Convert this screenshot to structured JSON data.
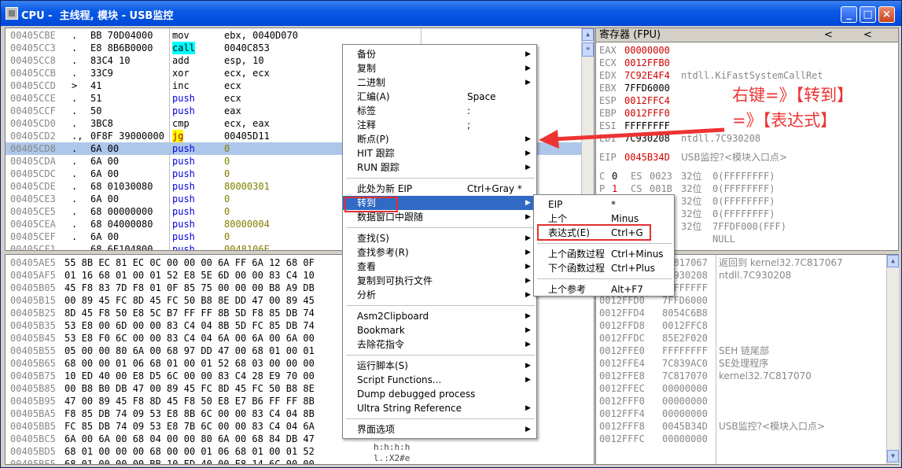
{
  "window": {
    "title": "CPU -  主线程, 模块 - USB监控",
    "min": "_",
    "max": "□",
    "close": "×"
  },
  "disasm": [
    {
      "addr": "00405CBE",
      "mark": ".",
      "hex": "BB 70D04000",
      "mn": "mov",
      "op": "ebx, 0040D070"
    },
    {
      "addr": "00405CC3",
      "mark": ".",
      "hex": "E8 8B6B0000",
      "mn": "call",
      "op": "0040C853"
    },
    {
      "addr": "00405CC8",
      "mark": ".",
      "hex": "83C4 10",
      "mn": "add",
      "op": "esp, 10"
    },
    {
      "addr": "00405CCB",
      "mark": ".",
      "hex": "33C9",
      "mn": "xor",
      "op": "ecx, ecx"
    },
    {
      "addr": "00405CCD",
      "mark": ">",
      "hex": "41",
      "mn": "inc",
      "op": "ecx"
    },
    {
      "addr": "00405CCE",
      "mark": ".",
      "hex": "51",
      "mn": "push",
      "op": "ecx"
    },
    {
      "addr": "00405CCF",
      "mark": ".",
      "hex": "50",
      "mn": "push",
      "op": "eax"
    },
    {
      "addr": "00405CD0",
      "mark": ".",
      "hex": "3BC8",
      "mn": "cmp",
      "op": "ecx, eax"
    },
    {
      "addr": "00405CD2",
      "mark": ".,",
      "hex": "0F8F 39000000",
      "mn": "jg",
      "op": "00405D11"
    },
    {
      "addr": "00405CD8",
      "mark": ".",
      "hex": "6A 00",
      "mn": "push",
      "op": "0"
    },
    {
      "addr": "00405CDA",
      "mark": ".",
      "hex": "6A 00",
      "mn": "push",
      "op": "0"
    },
    {
      "addr": "00405CDC",
      "mark": ".",
      "hex": "6A 00",
      "mn": "push",
      "op": "0"
    },
    {
      "addr": "00405CDE",
      "mark": ".",
      "hex": "68 01030080",
      "mn": "push",
      "op": "80000301"
    },
    {
      "addr": "00405CE3",
      "mark": ".",
      "hex": "6A 00",
      "mn": "push",
      "op": "0"
    },
    {
      "addr": "00405CE5",
      "mark": ".",
      "hex": "68 00000000",
      "mn": "push",
      "op": "0"
    },
    {
      "addr": "00405CEA",
      "mark": ".",
      "hex": "68 04000080",
      "mn": "push",
      "op": "80000004"
    },
    {
      "addr": "00405CEF",
      "mark": ".",
      "hex": "6A 00",
      "mn": "push",
      "op": "0"
    },
    {
      "addr": "00405CF1",
      "mark": ".",
      "hex": "68 6E104800",
      "mn": "push",
      "op": "0048106E"
    }
  ],
  "dump": [
    {
      "addr": "00405AE5",
      "hex": "55 8B EC 81 EC 0C 00 00 00 6A FF 6A 12 68 0F"
    },
    {
      "addr": "00405AF5",
      "hex": "01 16 68 01 00 01 52 E8 5E 6D 00 00 83 C4 10"
    },
    {
      "addr": "00405B05",
      "hex": "45 F8 83 7D F8 01 0F 85 75 00 00 00 B8 A9 DB"
    },
    {
      "addr": "00405B15",
      "hex": "00 89 45 FC 8D 45 FC 50 B8 8E DD 47 00 89 45"
    },
    {
      "addr": "00405B25",
      "hex": "8D 45 F8 50 E8 5C B7 FF FF 8B 5D F8 85 DB 74"
    },
    {
      "addr": "00405B35",
      "hex": "53 E8 00 6D 00 00 83 C4 04 8B 5D FC 85 DB 74"
    },
    {
      "addr": "00405B45",
      "hex": "53 E8 F0 6C 00 00 83 C4 04 6A 00 6A 00 6A 00"
    },
    {
      "addr": "00405B55",
      "hex": "05 00 00 80 6A 00 68 97 DD 47 00 68 01 00 01"
    },
    {
      "addr": "00405B65",
      "hex": "68 00 00 01 06 68 01 00 01 52 68 03 00 00 00"
    },
    {
      "addr": "00405B75",
      "hex": "10 ED 40 00 E8 D5 6C 00 00 83 C4 28 E9 70 00"
    },
    {
      "addr": "00405B85",
      "hex": "00 B8 B0 DB 47 00 89 45 FC 8D 45 FC 50 B8 8E"
    },
    {
      "addr": "00405B95",
      "hex": "47 00 89 45 F8 8D 45 F8 50 E8 E7 B6 FF FF 8B"
    },
    {
      "addr": "00405BA5",
      "hex": "F8 85 DB 74 09 53 E8 8B 6C 00 00 83 C4 04 8B"
    },
    {
      "addr": "00405BB5",
      "hex": "FC 85 DB 74 09 53 E8 7B 6C 00 00 83 C4 04 6A"
    },
    {
      "addr": "00405BC5",
      "hex": "6A 00 6A 00 68 04 00 00 80 6A 00 68 84 DB 47"
    },
    {
      "addr": "00405BD5",
      "hex": "68 01 00 00 00 68 00 00 01 06 68 01 00 01 52"
    },
    {
      "addr": "00405BE5",
      "hex": "68 01 00 00 00 BB 10 ED 40 00 E8 14 6C 00 00"
    }
  ],
  "dump_ascii": [
    "h:h:h:h",
    "l.:X2#e  "
  ],
  "registers": {
    "header": "寄存器 (FPU)",
    "nav": [
      "<",
      "<"
    ],
    "gp": [
      {
        "n": "EAX",
        "v": "00000000",
        "c": ""
      },
      {
        "n": "ECX",
        "v": "0012FFB0",
        "c": ""
      },
      {
        "n": "EDX",
        "v": "7C92E4F4",
        "c": "ntdll.KiFastSystemCallRet"
      },
      {
        "n": "EBX",
        "v": "7FFD6000",
        "c": ""
      },
      {
        "n": "ESP",
        "v": "0012FFC4",
        "c": ""
      },
      {
        "n": "EBP",
        "v": "0012FFF0",
        "c": ""
      },
      {
        "n": "ESI",
        "v": "FFFFFFFF",
        "c": ""
      },
      {
        "n": "EDI",
        "v": "7C930208",
        "c": "ntdll.7C930208"
      }
    ],
    "eip": {
      "n": "EIP",
      "v": "0045B34D",
      "c": "USB监控?<模块入口点>"
    },
    "seg": [
      {
        "f": "C",
        "b": "0",
        "s": "ES",
        "v": "0023",
        "w": "32位",
        "r": "0(FFFFFFFF)"
      },
      {
        "f": "P",
        "b": "1",
        "s": "CS",
        "v": "001B",
        "w": "32位",
        "r": "0(FFFFFFFF)"
      },
      {
        "f": "",
        "b": "",
        "s": "",
        "v": "",
        "w": "32位",
        "r": "0(FFFFFFFF)"
      },
      {
        "f": "",
        "b": "",
        "s": "",
        "v": "",
        "w": "32位",
        "r": "0(FFFFFFFF)"
      },
      {
        "f": "",
        "b": "",
        "s": "",
        "v": "",
        "w": "32位",
        "r": "7FFDF000(FFF)"
      },
      {
        "f": "",
        "b": "",
        "s": "",
        "v": "",
        "w": "",
        "r": "NULL"
      }
    ]
  },
  "stack": [
    {
      "a": "",
      "v": "7C817067",
      "c": "返回到 kernel32.7C817067"
    },
    {
      "a": "",
      "v": "7C930208",
      "c": "ntdll.7C930208"
    },
    {
      "a": "",
      "v": "FFFFFFFF",
      "c": ""
    },
    {
      "a": "0012FFD0",
      "v": "7FFD6000",
      "c": ""
    },
    {
      "a": "0012FFD4",
      "v": "8054C6B8",
      "c": ""
    },
    {
      "a": "0012FFD8",
      "v": "0012FFC8",
      "c": ""
    },
    {
      "a": "0012FFDC",
      "v": "85E2F020",
      "c": ""
    },
    {
      "a": "0012FFE0",
      "v": "FFFFFFFF",
      "c": "SEH 链尾部"
    },
    {
      "a": "0012FFE4",
      "v": "7C839AC0",
      "c": "SE处理程序"
    },
    {
      "a": "0012FFE8",
      "v": "7C817070",
      "c": "kernel32.7C817070"
    },
    {
      "a": "0012FFEC",
      "v": "00000000",
      "c": ""
    },
    {
      "a": "0012FFF0",
      "v": "00000000",
      "c": ""
    },
    {
      "a": "0012FFF4",
      "v": "00000000",
      "c": ""
    },
    {
      "a": "0012FFF8",
      "v": "0045B34D",
      "c": "USB监控?<模块入口点>"
    },
    {
      "a": "0012FFFC",
      "v": "00000000",
      "c": ""
    }
  ],
  "context_menu": {
    "groups": [
      [
        {
          "label": "备份",
          "sc": "",
          "arrow": true
        },
        {
          "label": "复制",
          "sc": "",
          "arrow": true
        },
        {
          "label": "二进制",
          "sc": "",
          "arrow": true
        },
        {
          "label": "汇编(A)",
          "sc": "Space",
          "arrow": false
        },
        {
          "label": "标签",
          "sc": ":",
          "arrow": false
        },
        {
          "label": "注释",
          "sc": ";",
          "arrow": false
        },
        {
          "label": "断点(P)",
          "sc": "",
          "arrow": true
        },
        {
          "label": "HIT 跟踪",
          "sc": "",
          "arrow": true
        },
        {
          "label": "RUN 跟踪",
          "sc": "",
          "arrow": true
        }
      ],
      [
        {
          "label": "此处为新 EIP",
          "sc": "Ctrl+Gray *",
          "arrow": false
        },
        {
          "label": "转到",
          "sc": "",
          "arrow": true
        },
        {
          "label": "数据窗口中跟随",
          "sc": "",
          "arrow": true
        }
      ],
      [
        {
          "label": "查找(S)",
          "sc": "",
          "arrow": true
        },
        {
          "label": "查找参考(R)",
          "sc": "",
          "arrow": true
        },
        {
          "label": "查看",
          "sc": "",
          "arrow": true
        },
        {
          "label": "复制到可执行文件",
          "sc": "",
          "arrow": true
        },
        {
          "label": "分析",
          "sc": "",
          "arrow": true
        }
      ],
      [
        {
          "label": "Asm2Clipboard",
          "sc": "",
          "arrow": true
        },
        {
          "label": "Bookmark",
          "sc": "",
          "arrow": true
        },
        {
          "label": "去除花指令",
          "sc": "",
          "arrow": true
        }
      ],
      [
        {
          "label": "运行脚本(S)",
          "sc": "",
          "arrow": true
        },
        {
          "label": "Script Functions...",
          "sc": "",
          "arrow": true
        },
        {
          "label": "Dump debugged process",
          "sc": "",
          "arrow": false
        },
        {
          "label": "Ultra String Reference",
          "sc": "",
          "arrow": true
        }
      ],
      [
        {
          "label": "界面选项",
          "sc": "",
          "arrow": true
        }
      ]
    ]
  },
  "submenu": {
    "groups": [
      [
        {
          "label": "EIP",
          "sc": "*"
        },
        {
          "label": "上个",
          "sc": "Minus"
        },
        {
          "label": "表达式(E)",
          "sc": "Ctrl+G"
        }
      ],
      [
        {
          "label": "上个函数过程",
          "sc": "Ctrl+Minus"
        },
        {
          "label": "下个函数过程",
          "sc": "Ctrl+Plus"
        }
      ],
      [
        {
          "label": "上个参考",
          "sc": "Alt+F7"
        }
      ]
    ]
  },
  "annotation": {
    "line1": "右键=》【转到】",
    "line2": "=》【表达式】",
    "color": "#ee3333"
  }
}
